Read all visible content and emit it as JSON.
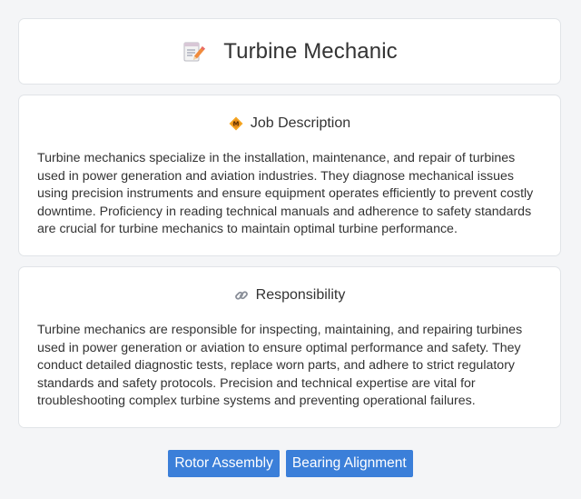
{
  "header": {
    "title": "Turbine Mechanic",
    "icon": "memo-pencil-icon"
  },
  "job_description": {
    "heading": "Job Description",
    "icon": "diamond-badge-icon",
    "text": "Turbine mechanics specialize in the installation, maintenance, and repair of turbines used in power generation and aviation industries. They diagnose mechanical issues using precision instruments and ensure equipment operates efficiently to prevent costly downtime. Proficiency in reading technical manuals and adherence to safety standards are crucial for turbine mechanics to maintain optimal turbine performance."
  },
  "responsibility": {
    "heading": "Responsibility",
    "icon": "link-icon",
    "text": "Turbine mechanics are responsible for inspecting, maintaining, and repairing turbines used in power generation or aviation to ensure optimal performance and safety. They conduct detailed diagnostic tests, replace worn parts, and adhere to strict regulatory standards and safety protocols. Precision and technical expertise are vital for troubleshooting complex turbine systems and preventing operational failures."
  },
  "tags": [
    {
      "label": "Rotor Assembly"
    },
    {
      "label": "Bearing Alignment"
    }
  ],
  "colors": {
    "tag_background": "#3b7fd9",
    "page_background": "#f4f5f7",
    "card_border": "#e1e4e8"
  }
}
